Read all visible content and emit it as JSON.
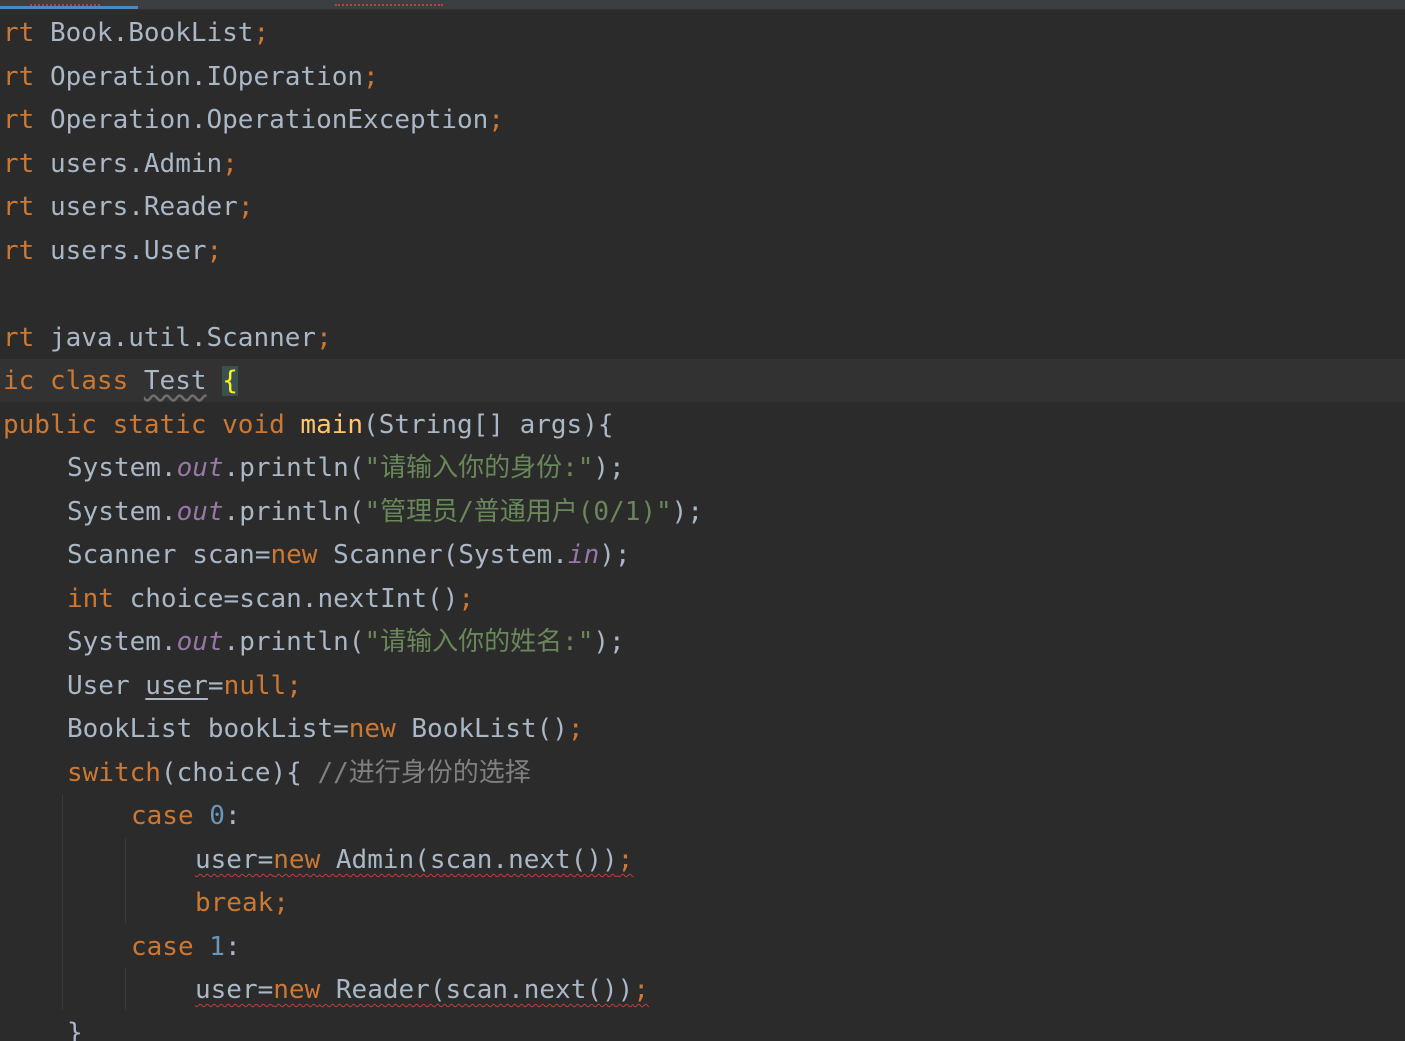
{
  "editor": {
    "colors": {
      "background": "#2b2b2b",
      "keyword": "#cc7832",
      "identifier": "#a9b7c6",
      "method": "#ffc66d",
      "string": "#6a8759",
      "number": "#6897bb",
      "static_field": "#9876aa",
      "comment": "#808080",
      "error_underline": "#bc3f3c"
    },
    "imports": [
      {
        "kw": "rt",
        "name": "Book.BookList"
      },
      {
        "kw": "rt",
        "name": "Operation.IOperation"
      },
      {
        "kw": "rt",
        "name": "Operation.OperationException"
      },
      {
        "kw": "rt",
        "name": "users.Admin"
      },
      {
        "kw": "rt",
        "name": "users.Reader"
      },
      {
        "kw": "rt",
        "name": "users.User"
      },
      {
        "kw": "rt",
        "name": "java.util.Scanner"
      }
    ],
    "semicolon": ";",
    "class_decl": {
      "modifier": "ic",
      "kw_class": "class",
      "name": "Test",
      "brace": "{"
    },
    "main_decl": {
      "mods": "public static void",
      "name": "main",
      "params": "(String[] args){"
    },
    "body": {
      "system": "System.",
      "out": "out",
      "println": ".println(",
      "prompt_identity": "\"请输入你的身份:\"",
      "prompt_role": "\"管理员/普通用户(0/1)\"",
      "close_paren_semi": ");",
      "scanner_type": "Scanner scan=",
      "kw_new": "new",
      "scanner_ctor": " Scanner(System.",
      "in": "in",
      "kw_int": "int",
      "choice_decl": " choice=scan.nextInt()",
      "prompt_name": "\"请输入你的姓名:\"",
      "user_type": "User ",
      "user_var": "user",
      "eq": "=",
      "kw_null": "null",
      "booklist_decl": "BookList bookList=",
      "booklist_ctor": " BookList()",
      "kw_switch": "switch",
      "switch_expr": "(choice){ ",
      "switch_comment": "//进行身份的选择",
      "kw_case": "case",
      "case0_val": "0",
      "case1_val": "1",
      "colon": ":",
      "user_assign": "user=",
      "admin_call": " Admin(scan.next())",
      "reader_call": " Reader(scan.next())",
      "kw_break": "break",
      "closing_brace": "}"
    }
  }
}
